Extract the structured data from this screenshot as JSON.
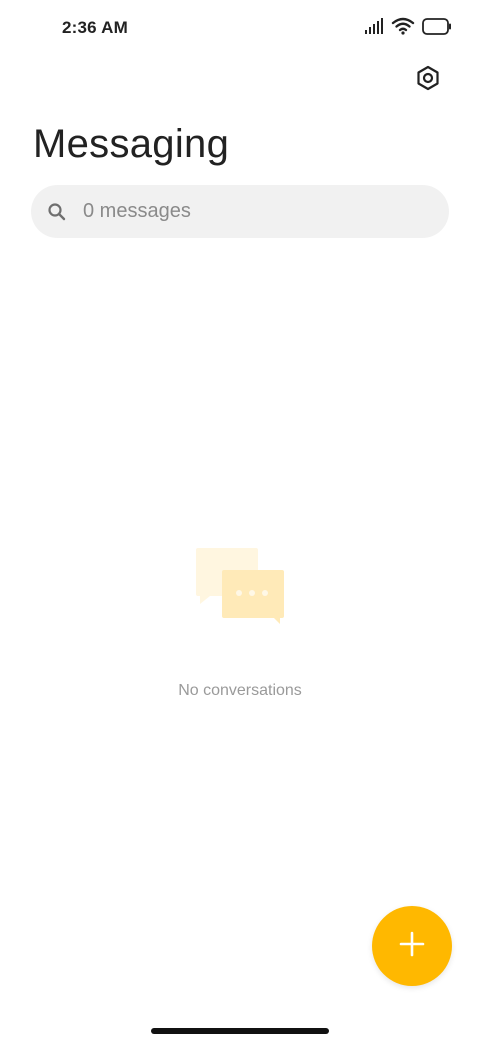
{
  "status_bar": {
    "time": "2:36 AM",
    "icons": [
      "signal-icon",
      "wifi-icon",
      "battery-icon"
    ]
  },
  "header": {
    "settings_icon": "settings-hexagon-icon",
    "title": "Messaging"
  },
  "search": {
    "icon": "search-icon",
    "placeholder": "0 messages"
  },
  "empty_state": {
    "icon": "chat-bubbles-icon",
    "message": "No conversations"
  },
  "fab": {
    "icon": "plus-icon",
    "color": "#ffb800"
  },
  "colors": {
    "accent": "#ffb800",
    "empty_icon_back": "#fff6e0",
    "empty_icon_front": "#ffeab8"
  }
}
